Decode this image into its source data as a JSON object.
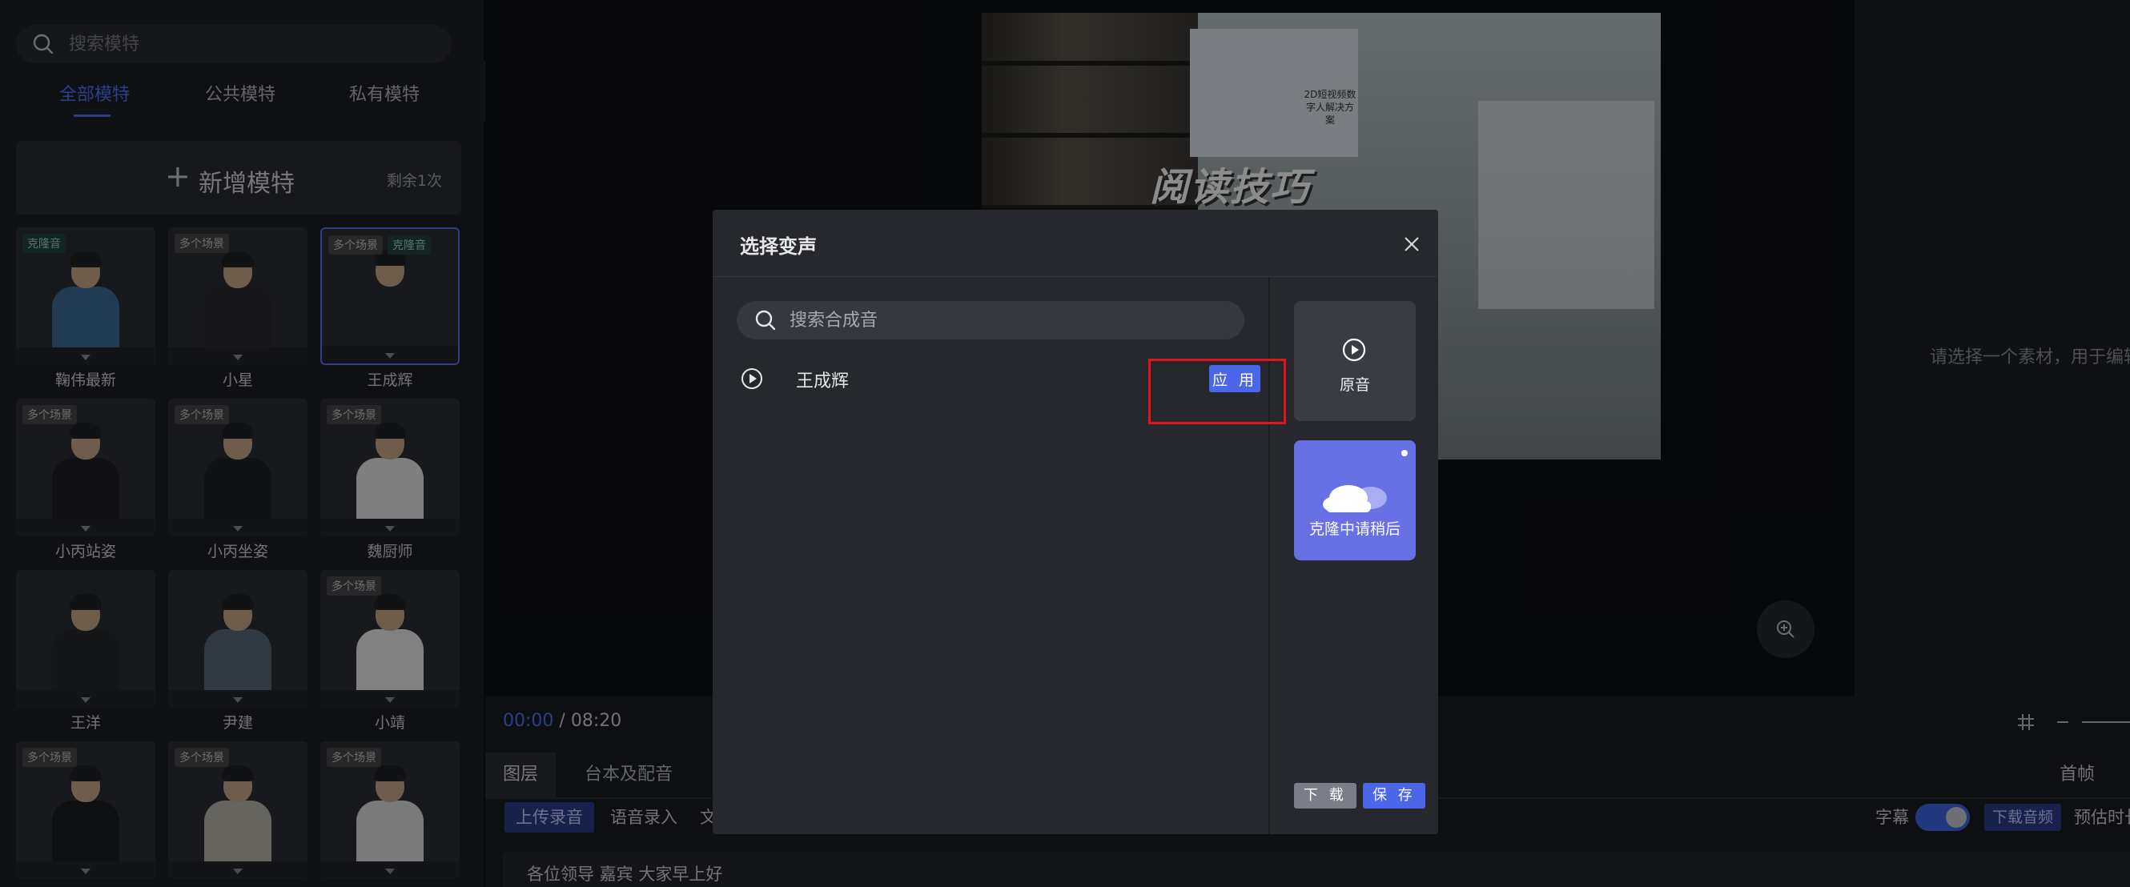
{
  "left_panel": {
    "search_placeholder": "搜索模特",
    "tabs": [
      {
        "label": "全部模特",
        "active": true
      },
      {
        "label": "公共模特",
        "active": false
      },
      {
        "label": "私有模特",
        "active": false
      }
    ],
    "add_model": {
      "label": "新增模特",
      "remaining": "剩余1次"
    },
    "models": [
      {
        "name": "鞠伟最新",
        "badges": [
          "克隆音"
        ]
      },
      {
        "name": "小星",
        "badges": [
          "多个场景"
        ]
      },
      {
        "name": "王成辉",
        "badges": [
          "多个场景",
          "克隆音"
        ],
        "selected": true
      },
      {
        "name": "小丙站姿",
        "badges": [
          "多个场景"
        ]
      },
      {
        "name": "小丙坐姿",
        "badges": [
          "多个场景"
        ]
      },
      {
        "name": "魏厨师",
        "badges": [
          "多个场景"
        ]
      },
      {
        "name": "王洋",
        "badges": []
      },
      {
        "name": "尹建",
        "badges": []
      },
      {
        "name": "小靖",
        "badges": [
          "多个场景"
        ]
      },
      {
        "name": "",
        "badges": [
          "多个场景"
        ]
      },
      {
        "name": "",
        "badges": [
          "多个场景"
        ]
      },
      {
        "name": "",
        "badges": [
          "多个场景"
        ]
      }
    ]
  },
  "preview": {
    "overlay_title": "阅读技巧",
    "screen_caption": "2D短视频数字人解决方案"
  },
  "right_panel": {
    "hint": "请选择一个素材，用于编辑"
  },
  "timeline": {
    "current": "00:00",
    "separator": "/",
    "total": "08:20",
    "tabs": [
      {
        "label": "图层",
        "active": true
      },
      {
        "label": "台本及配音",
        "active": false
      }
    ],
    "tools": {
      "upload": "上传录音",
      "voice_input": "语音录入",
      "text": "文"
    },
    "subtitle_label": "字幕",
    "subtitle_on": true,
    "download_audio": "下载音频",
    "estimate": "预估时长",
    "first_frame": "首帧",
    "script_text": "各位领导 嘉宾 大家早上好"
  },
  "modal": {
    "title": "选择变声",
    "search_placeholder": "搜索合成音",
    "voices": [
      {
        "name": "王成辉",
        "action": "应 用"
      }
    ],
    "original_label": "原音",
    "clone_label": "克隆中请稍后",
    "download_label": "下 载",
    "save_label": "保 存"
  },
  "colors": {
    "accent": "#4b66e8",
    "clone_card": "#6870e6",
    "highlight": "#e0141e"
  }
}
